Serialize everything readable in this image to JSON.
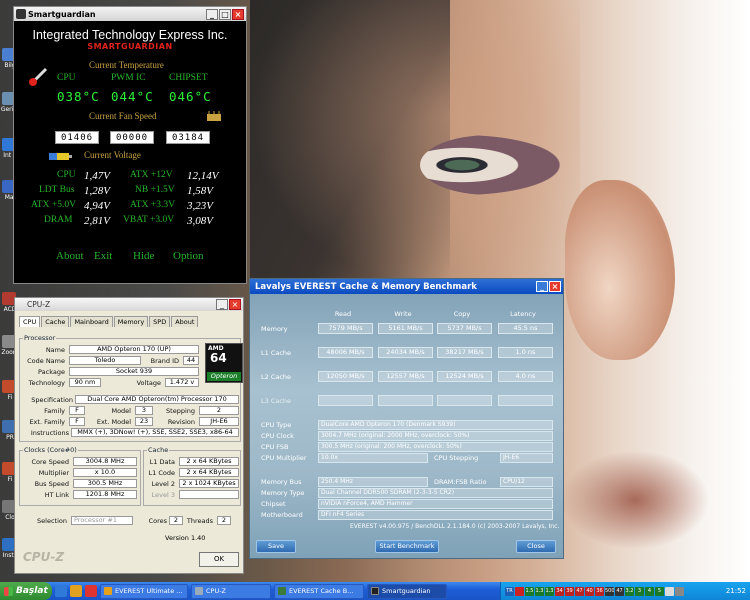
{
  "desktop": {
    "icons": [
      {
        "label": "Bilg",
        "color": "#4a7fd1"
      },
      {
        "label": "Geri K",
        "color": "#6a8fb0"
      },
      {
        "label": "İnt E",
        "color": "#2f78d8"
      },
      {
        "label": "Mai",
        "color": "#3a66c4"
      },
      {
        "label": "ACD",
        "color": "#b33a30"
      },
      {
        "label": "Zoom",
        "color": "#8a8a8a"
      },
      {
        "label": "Fi",
        "color": "#c14b2b"
      },
      {
        "label": "PR",
        "color": "#3f6fae"
      },
      {
        "label": "Fi",
        "color": "#c34a2a"
      },
      {
        "label": "Clo",
        "color": "#777"
      },
      {
        "label": "Insta",
        "color": "#2d6fc0"
      }
    ]
  },
  "smartguardian": {
    "title": "Smartguardian",
    "company": "Integrated Technology Express Inc.",
    "product": "SMARTGUARDIAN",
    "temp_title": "Current Temperature",
    "temp_labels": [
      "CPU",
      "PWM IC",
      "CHIPSET"
    ],
    "temps": [
      "038°C",
      "044°C",
      "046°C"
    ],
    "fan_title": "Current Fan Speed",
    "fans": [
      "01406",
      "00000",
      "03184"
    ],
    "volt_title": "Current Voltage",
    "voltages": [
      {
        "l1": "CPU",
        "v1": "1,47V",
        "l2": "ATX +12V",
        "v2": "12,14V"
      },
      {
        "l1": "LDT Bus",
        "v1": "1,28V",
        "l2": "NB +1.5V",
        "v2": "1,58V"
      },
      {
        "l1": "ATX +5.0V",
        "v1": "4,94V",
        "l2": "ATX +3.3V",
        "v2": "3,23V"
      },
      {
        "l1": "DRAM",
        "v1": "2,81V",
        "l2": "VBAT +3.0V",
        "v2": "3,08V"
      }
    ],
    "buttons": [
      "About",
      "Exit",
      "Hide",
      "Option"
    ]
  },
  "cpuz": {
    "title": "CPU-Z",
    "tabs": [
      "CPU",
      "Cache",
      "Mainboard",
      "Memory",
      "SPD",
      "About"
    ],
    "processor_group": "Processor",
    "name_label": "Name",
    "name": "AMD Opteron 170 (UP)",
    "codename_label": "Code Name",
    "codename": "Toledo",
    "brandid_label": "Brand ID",
    "brandid": "44",
    "package_label": "Package",
    "package": "Socket 939",
    "tech_label": "Technology",
    "tech": "90 nm",
    "voltage_label": "Voltage",
    "voltage": "1.472 v",
    "spec_label": "Specification",
    "spec": "Dual Core AMD Opteron(tm) Processor 170",
    "family_label": "Family",
    "family": "F",
    "model_label": "Model",
    "model": "3",
    "stepping_label": "Stepping",
    "stepping": "2",
    "extfamily_label": "Ext. Family",
    "extfamily": "F",
    "extmodel_label": "Ext. Model",
    "extmodel": "23",
    "revision_label": "Revision",
    "revision": "JH-E6",
    "instr_label": "Instructions",
    "instr": "MMX (+), 3DNow! (+), SSE, SSE2, SSE3, x86-64",
    "clocks_group": "Clocks (Core#0)",
    "corespeed_label": "Core Speed",
    "corespeed": "3004.8 MHz",
    "mult_label": "Multiplier",
    "mult": "x 10.0",
    "bus_label": "Bus Speed",
    "bus": "300.5 MHz",
    "ht_label": "HT Link",
    "ht": "1201.8 MHz",
    "cache_group": "Cache",
    "l1d_label": "L1 Data",
    "l1d": "2 x 64 KBytes",
    "l1c_label": "L1 Code",
    "l1c": "2 x 64 KBytes",
    "l2_label": "Level 2",
    "l2": "2 x 1024 KBytes",
    "l3_label": "Level 3",
    "selection_label": "Selection",
    "selection": "Processor #1",
    "cores_label": "Cores",
    "cores": "2",
    "threads_label": "Threads",
    "threads": "2",
    "version": "Version 1.40",
    "logo_text": "CPU-Z",
    "amd_text": "AMD",
    "amd_num": "64",
    "amd_bar": "Opteron"
  },
  "everest": {
    "title": "Lavalys EVEREST Cache & Memory Benchmark",
    "headers": [
      "Read",
      "Write",
      "Copy",
      "Latency"
    ],
    "rows": [
      {
        "label": "Memory",
        "vals": [
          "7579 MB/s",
          "5161 MB/s",
          "5737 MB/s",
          "45.5 ns"
        ]
      },
      {
        "label": "L1 Cache",
        "vals": [
          "48006 MB/s",
          "24034 MB/s",
          "38217 MB/s",
          "1.0 ns"
        ]
      },
      {
        "label": "L2 Cache",
        "vals": [
          "12050 MB/s",
          "12557 MB/s",
          "12524 MB/s",
          "4.0 ns"
        ]
      },
      {
        "label": "L3 Cache",
        "vals": [
          "",
          "",
          "",
          ""
        ]
      }
    ],
    "cpu_type_label": "CPU Type",
    "cpu_type": "DualCore AMD Opteron 170  (Denmark S939)",
    "cpu_clock_label": "CPU Clock",
    "cpu_clock": "3004.7 MHz  (original: 2000 MHz, overclock: 50%)",
    "cpu_fsb_label": "CPU FSB",
    "cpu_fsb": "300.5 MHz  (original: 200 MHz, overclock: 50%)",
    "cpu_mult_label": "CPU Multiplier",
    "cpu_mult": "10.0x",
    "cpu_step_label": "CPU Stepping",
    "cpu_step": "JH-E6",
    "mem_bus_label": "Memory Bus",
    "mem_bus": "250.4 MHz",
    "dram_ratio_label": "DRAM:FSB Ratio",
    "dram_ratio": "CPU/12",
    "mem_type_label": "Memory Type",
    "mem_type": "Dual Channel DDR500 SDRAM  (2-3-3-5 CR2)",
    "chipset_label": "Chipset",
    "chipset": "nVIDIA nForce4, AMD Hammer",
    "mobo_label": "Motherboard",
    "mobo": "DFI nF4 Series",
    "footer": "EVEREST v4.00.975 / BenchDLL 2.1.184.0  (c) 2003-2007 Lavalys, Inc.",
    "save": "Save",
    "start": "Start Benchmark",
    "close": "Close"
  },
  "taskbar": {
    "start": "Başlat",
    "tasks": [
      {
        "label": "EVEREST Ultimate ...",
        "color": "#e6a11a"
      },
      {
        "label": "CPU-Z",
        "color": "#9ab"
      },
      {
        "label": "EVEREST Cache B...",
        "color": "#3b7b3a"
      },
      {
        "label": "Smartguardian",
        "color": "#222"
      }
    ],
    "tray": [
      "TR",
      "1.5",
      "1.3",
      "1.3",
      "34",
      "39",
      "47",
      "40",
      "36",
      "500",
      "47",
      "3.2",
      "3",
      "4",
      "5"
    ],
    "clock": "21:52"
  }
}
